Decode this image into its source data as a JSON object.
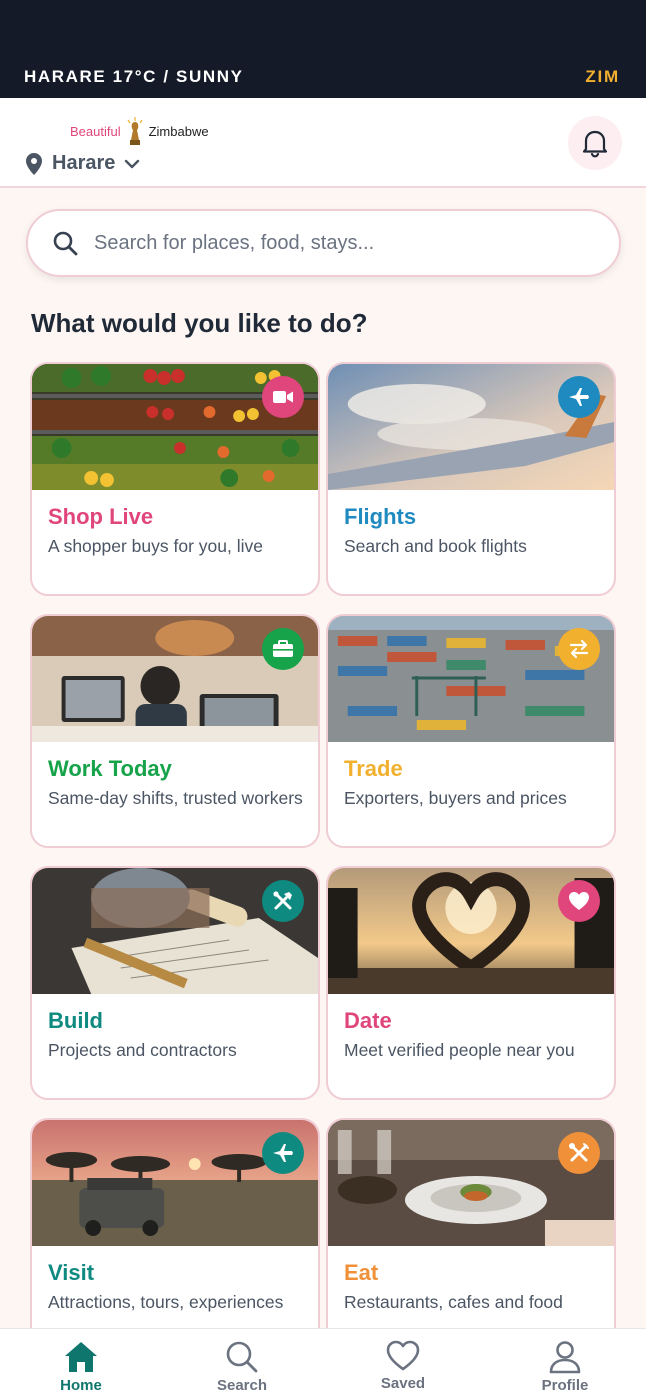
{
  "status": {
    "weather": "HARARE 17°C / SUNNY",
    "country": "ZIM"
  },
  "header": {
    "brand_left": "Beautiful",
    "brand_right": "Zimbabwe",
    "location": "Harare"
  },
  "search": {
    "placeholder": "Search for places, food, stays..."
  },
  "section_title": "What would you like to do?",
  "cards": [
    {
      "title": "Shop Live",
      "desc": "A shopper buys for you, live",
      "color": "#e0457b",
      "icon": "video-icon"
    },
    {
      "title": "Flights",
      "desc": "Search and book flights",
      "color": "#1f8ac0",
      "icon": "plane-icon"
    },
    {
      "title": "Work Today",
      "desc": "Same-day shifts, trusted workers",
      "color": "#16a34a",
      "icon": "briefcase-icon"
    },
    {
      "title": "Trade",
      "desc": "Exporters, buyers and prices",
      "color": "#f2b02f",
      "icon": "exchange-icon"
    },
    {
      "title": "Build",
      "desc": "Projects and contractors",
      "color": "#0f8a80",
      "icon": "tools-icon"
    },
    {
      "title": "Date",
      "desc": "Meet verified people near you",
      "color": "#e0457b",
      "icon": "heart-icon"
    },
    {
      "title": "Visit",
      "desc": "Attractions, tours, experiences",
      "color": "#0f8a80",
      "icon": "plane-icon"
    },
    {
      "title": "Eat",
      "desc": "Restaurants, cafes and food",
      "color": "#f0913a",
      "icon": "utensils-icon"
    }
  ],
  "nav": [
    {
      "label": "Home",
      "icon": "home-icon",
      "active": true
    },
    {
      "label": "Search",
      "icon": "search-icon",
      "active": false
    },
    {
      "label": "Saved",
      "icon": "heart-outline-icon",
      "active": false
    },
    {
      "label": "Profile",
      "icon": "user-icon",
      "active": false
    }
  ]
}
